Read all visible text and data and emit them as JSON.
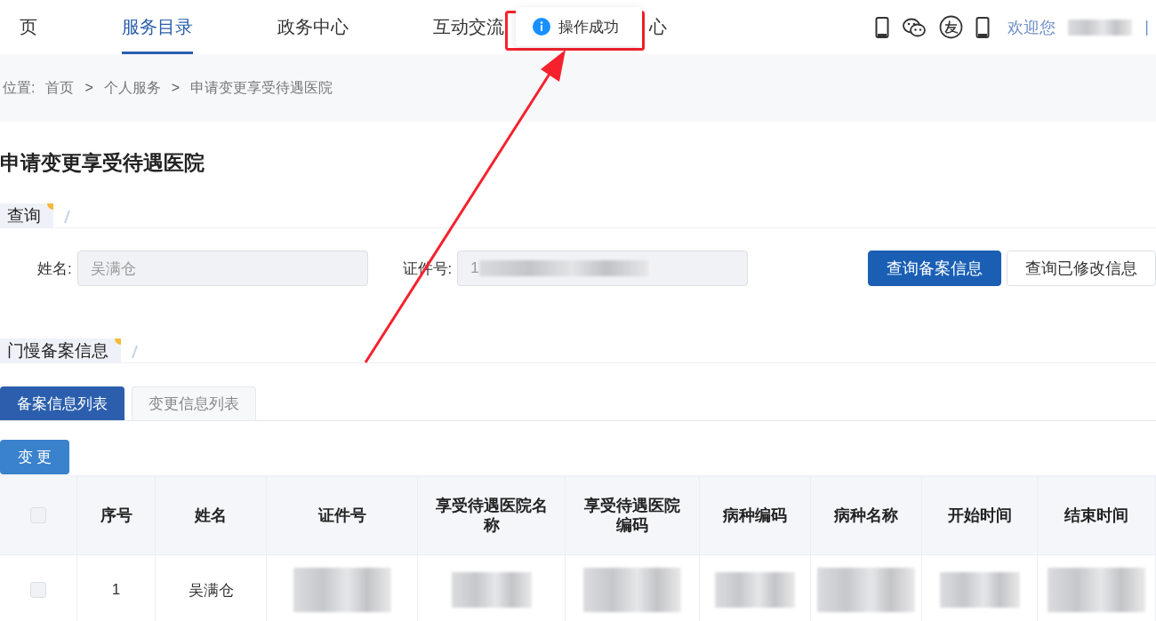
{
  "nav": {
    "items": [
      {
        "label": "页",
        "selected": false
      },
      {
        "label": "服务目录",
        "selected": true
      },
      {
        "label": "政务中心",
        "selected": false
      },
      {
        "label": "互动交流",
        "selected": false
      },
      {
        "label": "心",
        "selected": false
      }
    ],
    "user": {
      "greeting": "欢迎您",
      "name_redacted": true,
      "separator": "|"
    }
  },
  "toast": {
    "message": "操作成功",
    "annotated": true
  },
  "breadcrumb": {
    "prefix": "位置:",
    "items": [
      {
        "label": "首页"
      },
      {
        "label": "个人服务"
      },
      {
        "label": "申请变更享受待遇医院"
      }
    ],
    "separator": ">"
  },
  "title": "申请变更享受待遇医院",
  "query_section": {
    "heading": "查询",
    "fields": [
      {
        "label": "姓名:",
        "value": "吴满仓",
        "redacted": false
      },
      {
        "label": "证件号:",
        "value": "1",
        "redacted": true
      }
    ],
    "buttons": [
      {
        "label": "查询备案信息",
        "kind": "primary"
      },
      {
        "label": "查询已修改信息",
        "kind": "default"
      }
    ]
  },
  "records_section": {
    "heading": "门慢备案信息",
    "tabs": [
      {
        "label": "备案信息列表",
        "selected": true
      },
      {
        "label": "变更信息列表",
        "selected": false
      }
    ],
    "action": "变 更",
    "table": {
      "columns": [
        "序号",
        "姓名",
        "证件号",
        "享受待遇医院名称",
        "享受待遇医院编码",
        "病种编码",
        "病种名称",
        "开始时间",
        "结束时间"
      ],
      "header_checked": false,
      "rows": [
        {
          "checked": false,
          "cells": [
            {
              "kind": "text",
              "text": "1"
            },
            {
              "kind": "text",
              "text": "吴满仓"
            },
            {
              "kind": "redacted"
            },
            {
              "kind": "redacted"
            },
            {
              "kind": "redacted"
            },
            {
              "kind": "redacted"
            },
            {
              "kind": "redacted"
            },
            {
              "kind": "redacted"
            },
            {
              "kind": "redacted"
            }
          ]
        }
      ]
    }
  }
}
